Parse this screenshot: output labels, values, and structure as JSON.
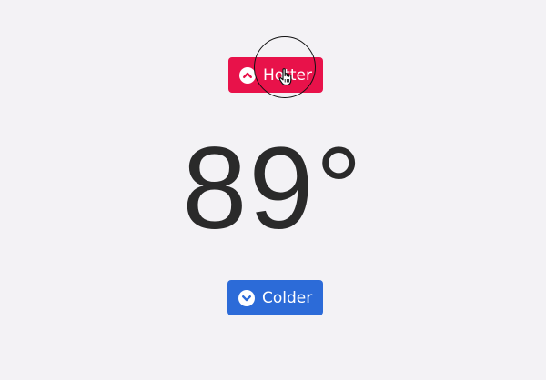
{
  "hotter": {
    "label": "Hotter",
    "icon": "chevron-up-circle-icon",
    "color": "#e8124a"
  },
  "temperature": {
    "value": "89°"
  },
  "colder": {
    "label": "Colder",
    "icon": "chevron-down-circle-icon",
    "color": "#2c6bd8"
  },
  "background": "#f3f2f5"
}
